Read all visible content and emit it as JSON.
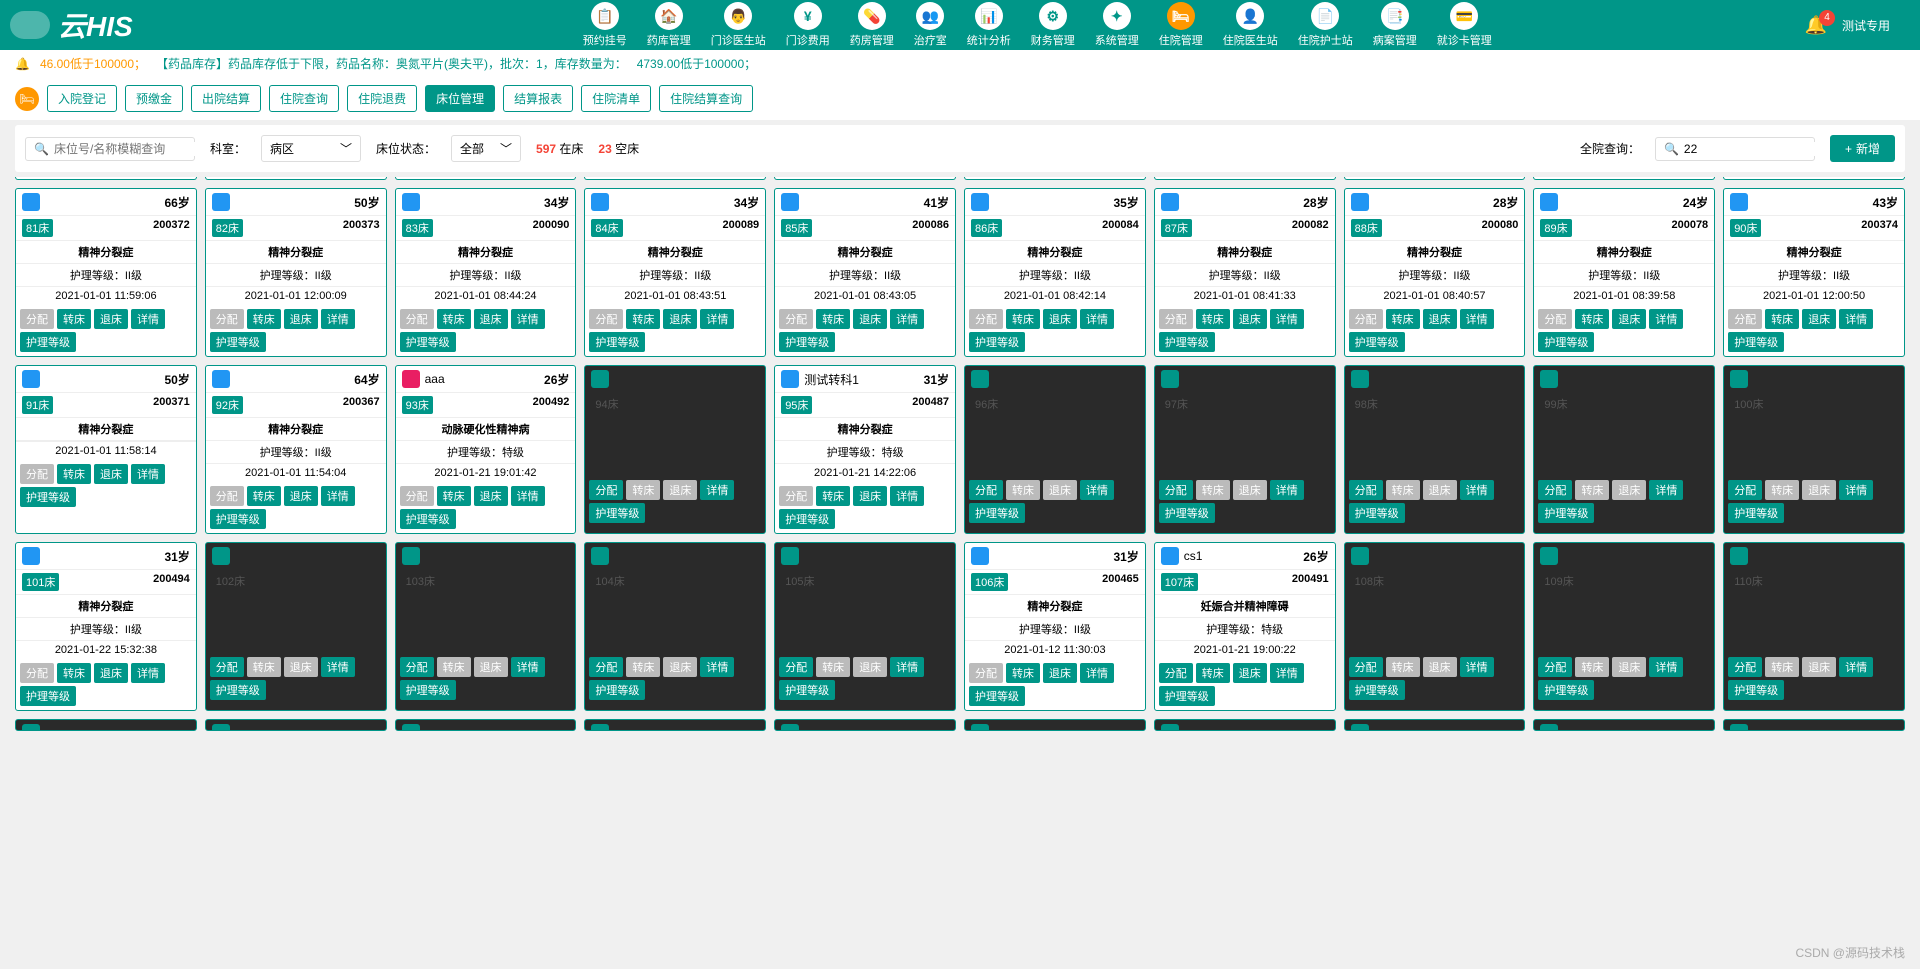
{
  "header": {
    "logo": "云HIS",
    "user": "测试专用",
    "badge": "4",
    "nav": [
      {
        "label": "预约挂号",
        "icon": "📋"
      },
      {
        "label": "药库管理",
        "icon": "🏠"
      },
      {
        "label": "门诊医生站",
        "icon": "👨"
      },
      {
        "label": "门诊费用",
        "icon": "¥"
      },
      {
        "label": "药房管理",
        "icon": "💊"
      },
      {
        "label": "治疗室",
        "icon": "👥"
      },
      {
        "label": "统计分析",
        "icon": "📊"
      },
      {
        "label": "财务管理",
        "icon": "⚙"
      },
      {
        "label": "系统管理",
        "icon": "✦"
      },
      {
        "label": "住院管理",
        "icon": "🛏",
        "active": true
      },
      {
        "label": "住院医生站",
        "icon": "👤"
      },
      {
        "label": "住院护士站",
        "icon": "📄"
      },
      {
        "label": "病案管理",
        "icon": "📑"
      },
      {
        "label": "就诊卡管理",
        "icon": "💳"
      }
    ]
  },
  "notice": {
    "text1": "46.00低于100000；",
    "text2": "【药品库存】药品库存低于下限，药品名称：奥氮平片(奥夫平)，批次：1，库存数量为：",
    "text3": "4739.00低于100000；"
  },
  "subnav": {
    "tabs": [
      "入院登记",
      "预缴金",
      "出院结算",
      "住院查询",
      "住院退费",
      "床位管理",
      "结算报表",
      "住院清单",
      "住院结算查询"
    ],
    "active": 5
  },
  "filter": {
    "search_placeholder": "床位号/名称模糊查询",
    "dept_label": "科室：",
    "dept_value": "病区",
    "status_label": "床位状态：",
    "status_value": "全部",
    "stat1_num": "597",
    "stat1_label": "在床",
    "stat2_num": "23",
    "stat2_label": "空床",
    "global_label": "全院查询：",
    "global_value": "22",
    "add_btn": "新增"
  },
  "btn_labels": {
    "assign": "分配",
    "transfer": "转床",
    "back": "退床",
    "detail": "详情",
    "level": "护理等级"
  },
  "care_prefix": "护理等级：",
  "beds_row1": [
    {
      "age": "66岁",
      "bed": "81床",
      "pid": "200372",
      "diag": "精神分裂症",
      "care": "II级",
      "time": "2021-01-01 11:59:06",
      "ad": true
    },
    {
      "age": "50岁",
      "bed": "82床",
      "pid": "200373",
      "diag": "精神分裂症",
      "care": "II级",
      "time": "2021-01-01 12:00:09",
      "ad": true
    },
    {
      "age": "34岁",
      "bed": "83床",
      "pid": "200090",
      "diag": "精神分裂症",
      "care": "II级",
      "time": "2021-01-01 08:44:24",
      "ad": true
    },
    {
      "age": "34岁",
      "bed": "84床",
      "pid": "200089",
      "diag": "精神分裂症",
      "care": "II级",
      "time": "2021-01-01 08:43:51",
      "ad": true
    },
    {
      "age": "41岁",
      "bed": "85床",
      "pid": "200086",
      "diag": "精神分裂症",
      "care": "II级",
      "time": "2021-01-01 08:43:05",
      "ad": true
    },
    {
      "age": "35岁",
      "bed": "86床",
      "pid": "200084",
      "diag": "精神分裂症",
      "care": "II级",
      "time": "2021-01-01 08:42:14",
      "ad": true
    },
    {
      "age": "28岁",
      "bed": "87床",
      "pid": "200082",
      "diag": "精神分裂症",
      "care": "II级",
      "time": "2021-01-01 08:41:33",
      "ad": true
    },
    {
      "age": "28岁",
      "bed": "88床",
      "pid": "200080",
      "diag": "精神分裂症",
      "care": "II级",
      "time": "2021-01-01 08:40:57",
      "ad": true
    },
    {
      "age": "24岁",
      "bed": "89床",
      "pid": "200078",
      "diag": "精神分裂症",
      "care": "II级",
      "time": "2021-01-01 08:39:58",
      "ad": true
    },
    {
      "age": "43岁",
      "bed": "90床",
      "pid": "200374",
      "diag": "精神分裂症",
      "care": "II级",
      "time": "2021-01-01 12:00:50",
      "ad": true
    }
  ],
  "beds_row2": [
    {
      "age": "50岁",
      "bed": "91床",
      "pid": "200371",
      "diag": "精神分裂症",
      "care": "",
      "time": "2021-01-01 11:58:14",
      "ad": true,
      "nocare": true
    },
    {
      "age": "64岁",
      "bed": "92床",
      "pid": "200367",
      "diag": "精神分裂症",
      "care": "II级",
      "time": "2021-01-01 11:54:04",
      "ad": true
    },
    {
      "name": "aaa",
      "age": "26岁",
      "bed": "93床",
      "pid": "200492",
      "diag": "动脉硬化性精神病",
      "care": "特级",
      "time": "2021-01-21 19:01:42",
      "ad": true,
      "female": true
    },
    {
      "bed": "94床",
      "empty": true
    },
    {
      "name": "测试转科1",
      "age": "31岁",
      "bed": "95床",
      "pid": "200487",
      "diag": "精神分裂症",
      "care": "特级",
      "time": "2021-01-21 14:22:06",
      "ad": true
    },
    {
      "bed": "96床",
      "empty": true
    },
    {
      "bed": "97床",
      "empty": true
    },
    {
      "bed": "98床",
      "empty": true
    },
    {
      "bed": "99床",
      "empty": true
    },
    {
      "bed": "100床",
      "empty": true
    }
  ],
  "beds_row3": [
    {
      "age": "31岁",
      "bed": "101床",
      "pid": "200494",
      "diag": "精神分裂症",
      "care": "II级",
      "time": "2021-01-22 15:32:38",
      "ad": true
    },
    {
      "bed": "102床",
      "empty": true
    },
    {
      "bed": "103床",
      "empty": true
    },
    {
      "bed": "104床",
      "empty": true
    },
    {
      "bed": "105床",
      "empty": true
    },
    {
      "age": "31岁",
      "bed": "106床",
      "pid": "200465",
      "diag": "精神分裂症",
      "care": "II级",
      "time": "2021-01-12 11:30:03",
      "ad": true
    },
    {
      "name": "cs1",
      "age": "26岁",
      "bed": "107床",
      "pid": "200491",
      "diag": "妊娠合并精神障碍",
      "care": "特级",
      "time": "2021-01-21 19:00:22"
    },
    {
      "bed": "108床",
      "empty": true
    },
    {
      "bed": "109床",
      "empty": true
    },
    {
      "bed": "110床",
      "empty": true
    }
  ],
  "watermark": "CSDN @源码技术栈"
}
